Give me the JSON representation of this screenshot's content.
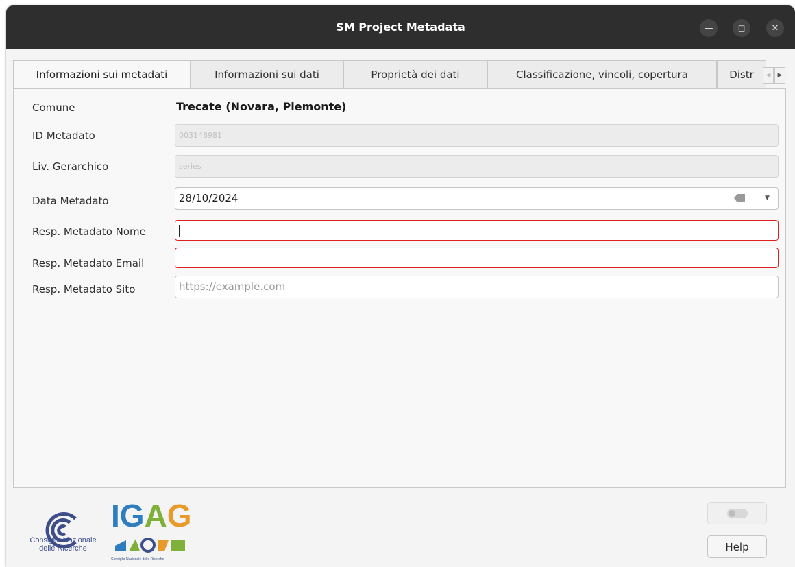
{
  "window": {
    "title": "SM Project Metadata",
    "controls": [
      "minimize",
      "maximize",
      "close"
    ]
  },
  "tabs": [
    {
      "label": "Informazioni sui metadati",
      "active": true
    },
    {
      "label": "Informazioni sui dati",
      "active": false
    },
    {
      "label": "Proprietà dei dati",
      "active": false
    },
    {
      "label": "Classificazione, vincoli, copertura",
      "active": false
    },
    {
      "label": "Distr",
      "active": false
    }
  ],
  "form": {
    "comune_label": "Comune",
    "comune_value": "Trecate (Novara, Piemonte)",
    "id_label": "ID Metadato",
    "id_value": "003148981",
    "livello_label": "Liv. Gerarchico",
    "livello_value": "series",
    "data_label": "Data Metadato",
    "data_value": "28/10/2024",
    "nome_label": "Resp. Metadato Nome",
    "nome_value": "",
    "email_label": "Resp. Metadato Email",
    "email_value": "",
    "sito_label": "Resp. Metadato Sito",
    "sito_placeholder": "https://example.com"
  },
  "footer": {
    "cnr_line1": "Consiglio Nazionale",
    "cnr_line2": "delle Ricerche",
    "igag_text": "IGAG",
    "igag_sub": "Consiglio Nazionale delle Ricerche",
    "action_button_icon": "toggle-icon",
    "help_label": "Help"
  },
  "colors": {
    "titlebar": "#2e2e2e",
    "error_border": "#e02020",
    "cnr_blue": "#3d4e8a",
    "igag_blue": "#2e7dbf",
    "igag_green": "#7fb03a",
    "igag_orange": "#e89b2a"
  }
}
